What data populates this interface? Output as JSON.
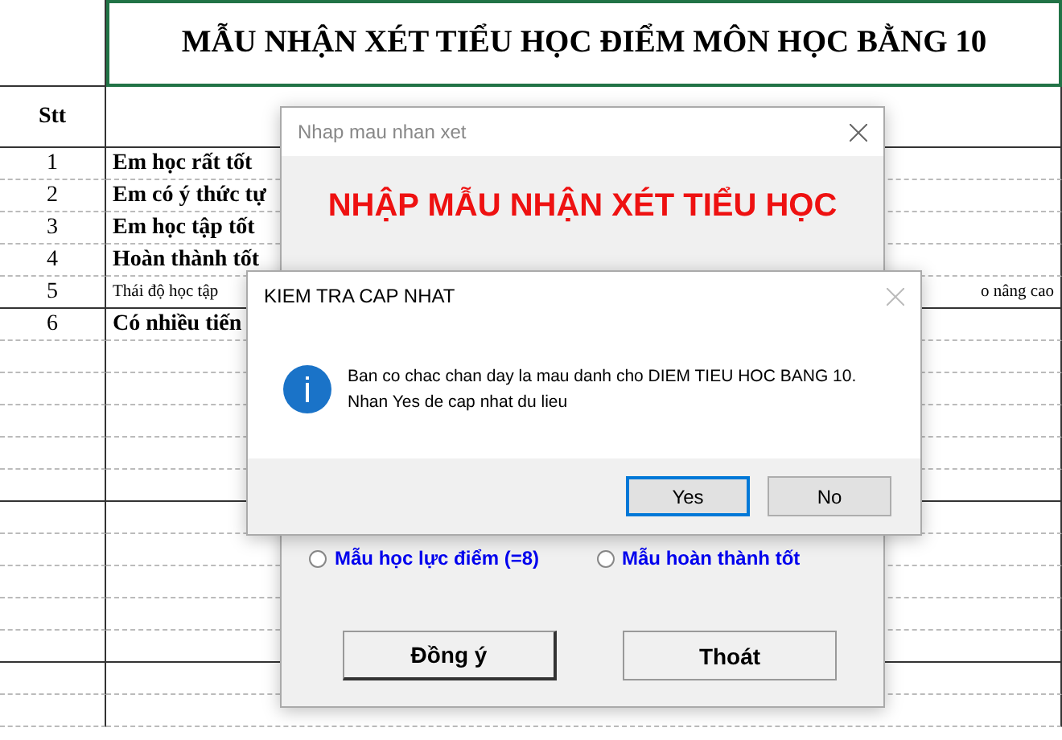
{
  "sheet": {
    "title": "MẪU NHẬN XÉT TIỂU HỌC ĐIỂM MÔN HỌC BẰNG 10",
    "header": "Stt",
    "rows": [
      {
        "stt": "1",
        "text": "Em học rất tốt",
        "small": false
      },
      {
        "stt": "2",
        "text": "Em có ý thức tự",
        "small": false
      },
      {
        "stt": "3",
        "text": "Em học tập tốt",
        "small": false
      },
      {
        "stt": "4",
        "text": "Hoàn thành tốt",
        "small": false
      },
      {
        "stt": "5",
        "text": "Thái độ học tập",
        "tail": "o nâng cao",
        "small": true
      },
      {
        "stt": "6",
        "text": "Có nhiều tiến",
        "small": false
      }
    ]
  },
  "form": {
    "title": "Nhap mau nhan xet",
    "heading": "NHẬP MẪU NHẬN XÉT TIỂU HỌC",
    "options": [
      {
        "label": "Mẫu học lực điểm (=8)",
        "selected": false
      },
      {
        "label": "Mẫu hoàn thành tốt",
        "selected": false
      }
    ],
    "buttons": [
      {
        "label": "Đồng ý",
        "default": true
      },
      {
        "label": "Thoát",
        "default": false
      }
    ]
  },
  "message": {
    "title": "KIEM TRA CAP NHAT",
    "text": [
      "Ban co chac chan day la mau danh cho DIEM TIEU HOC BANG 10.",
      "Nhan Yes de cap nhat du lieu"
    ],
    "buttons": [
      {
        "label": "Yes",
        "default": true
      },
      {
        "label": "No",
        "default": false
      }
    ]
  }
}
